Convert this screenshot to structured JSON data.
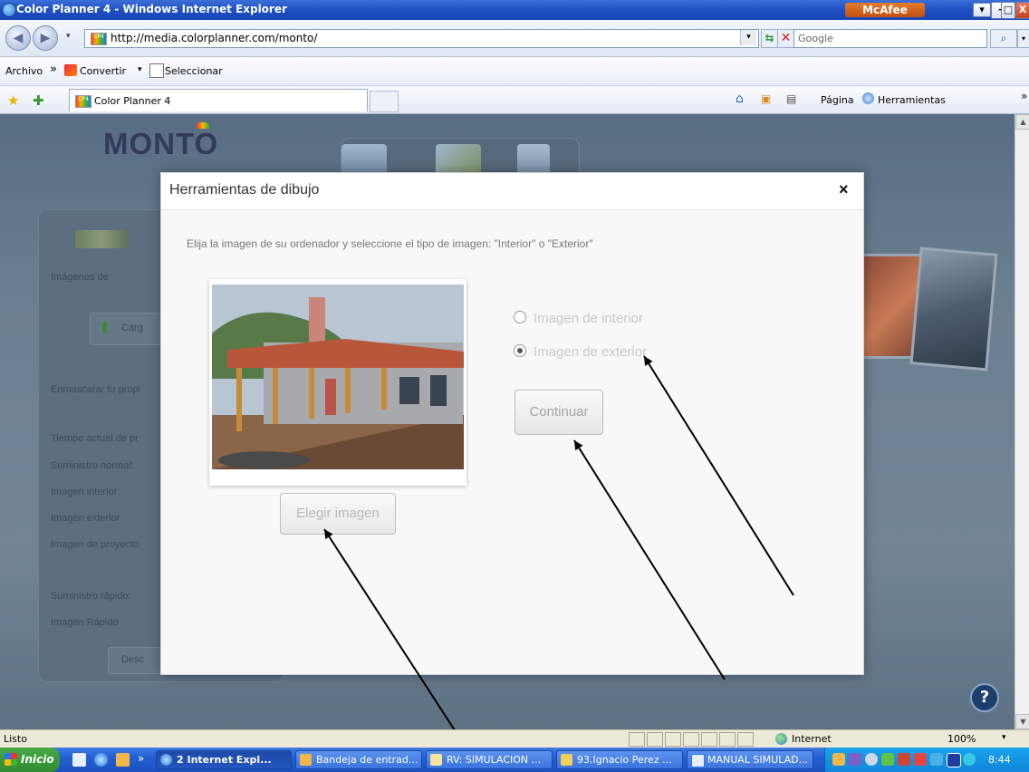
{
  "window": {
    "title": "Color Planner 4 - Windows Internet Explorer",
    "mcafee_label": "McAfee",
    "controls": [
      "-",
      "□",
      "X"
    ]
  },
  "addressbar": {
    "url": "http://media.colorplanner.com/monto/",
    "search_placeholder": "Google",
    "favicon_text": "CP4"
  },
  "menubar": {
    "archivo": "Archivo",
    "chevron": "»",
    "convertir": "Convertir",
    "seleccionar": "Seleccionar"
  },
  "favbar": {
    "tab_title": "Color Planner 4",
    "pagina": "Página",
    "herramientas": "Herramientas",
    "chevron": "»"
  },
  "background_app": {
    "logo": "MONTO",
    "left_panel": {
      "tab_label": "Imágenes de",
      "upload_button": "Carg",
      "mask_text": "Enmascarar tu propi",
      "time_label": "Tiempo actual de pr",
      "normal_supply": "Suministro normal:",
      "interior_image": "Imagen interior",
      "exterior_image": "Imagen exterior",
      "project_image": "Imagen de proyecto",
      "fast_supply": "Suministro rápido:",
      "fast_image": "Imagen Rápido",
      "download_button": "Desc"
    },
    "help_icon_text": "?"
  },
  "modal": {
    "title": "Herramientas de dibujo",
    "close": "×",
    "instruction": "Elija la imagen de su ordenador y seleccione el tipo de imagen: \"Interior\" o \"Exterior\"",
    "choose_button": "Elegir imagen",
    "radio_interior": "Imagen de interior",
    "radio_exterior": "Imagen de exterior",
    "selected_option": "Imagen de exterior",
    "continue_button": "Continuar"
  },
  "statusbar": {
    "status": "Listo",
    "zone": "Internet",
    "zoom": "100%"
  },
  "taskbar": {
    "start": "Inicio",
    "chevron": "»",
    "items": [
      "2 Internet Expl...",
      "Bandeja de entrad...",
      "RV: SIMULACION ...",
      "93.Ignacio Perez ...",
      "MANUAL SIMULAD..."
    ],
    "clock": "8:44"
  }
}
